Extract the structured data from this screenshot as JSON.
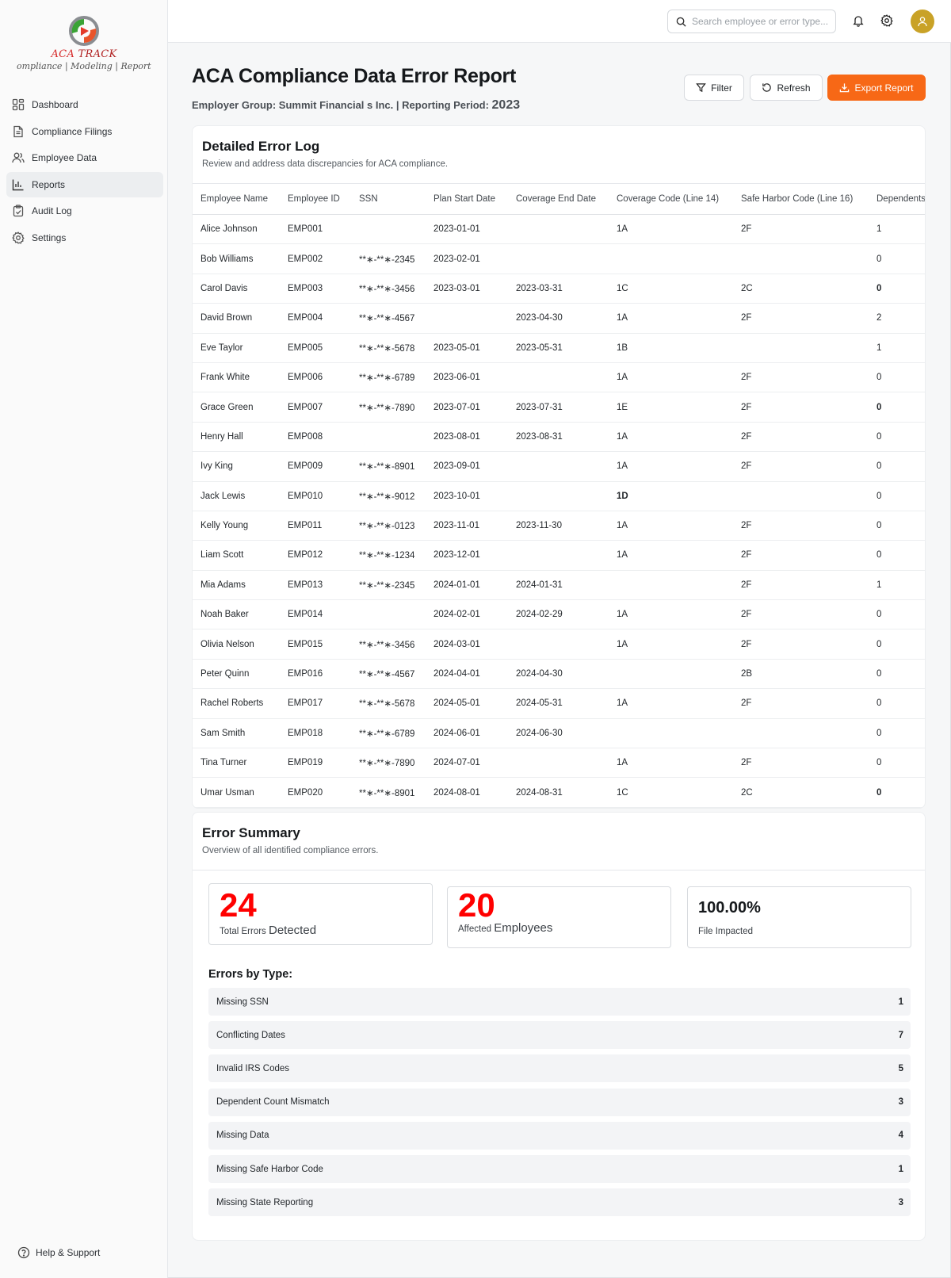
{
  "brand": {
    "name_a": "ACA",
    "name_b": "TRACK",
    "tagline": "ompliance | Modeling | Reportin"
  },
  "sidebar": {
    "items": [
      {
        "label": "Dashboard",
        "icon": "dashboard-icon"
      },
      {
        "label": "Compliance Filings",
        "icon": "document-icon"
      },
      {
        "label": "Employee Data",
        "icon": "users-icon"
      },
      {
        "label": "Reports",
        "icon": "bar-chart-icon",
        "active": true
      },
      {
        "label": "Audit Log",
        "icon": "clipboard-check-icon"
      },
      {
        "label": "Settings",
        "icon": "gear-icon"
      }
    ],
    "help_label": "Help & Support"
  },
  "topbar": {
    "search_placeholder": "Search employee or error type..."
  },
  "header": {
    "title": "ACA Compliance Data Error Report",
    "subtitle_prefix": "Employer Group: Summit Financial s Inc. | Reporting Period: ",
    "subtitle_year": "2023",
    "filter_label": "Filter",
    "refresh_label": "Refresh",
    "export_label": "Export Report"
  },
  "error_log": {
    "title": "Detailed Error Log",
    "description": "Review and address data discrepancies for ACA compliance.",
    "columns": [
      "Employee Name",
      "Employee ID",
      "SSN",
      "Plan Start Date",
      "Coverage End Date",
      "Coverage Code (Line 14)",
      "Safe Harbor Code (Line 16)",
      "Dependents"
    ],
    "rows": [
      [
        "Alice Johnson",
        "EMP001",
        "",
        "2023-01-01",
        "",
        "1A",
        "2F",
        "1"
      ],
      [
        "Bob Williams",
        "EMP002",
        "**∗-**∗-2345",
        "2023-02-01",
        "",
        "",
        "",
        "0"
      ],
      [
        "Carol Davis",
        "EMP003",
        "**∗-**∗-3456",
        "2023-03-01",
        "2023-03-31",
        "1C",
        "2C",
        "0"
      ],
      [
        "David Brown",
        "EMP004",
        "**∗-**∗-4567",
        "",
        "2023-04-30",
        "1A",
        "2F",
        "2"
      ],
      [
        "Eve Taylor",
        "EMP005",
        "**∗-**∗-5678",
        "2023-05-01",
        "2023-05-31",
        "1B",
        "",
        "1"
      ],
      [
        "Frank White",
        "EMP006",
        "**∗-**∗-6789",
        "2023-06-01",
        "",
        "1A",
        "2F",
        "0"
      ],
      [
        "Grace Green",
        "EMP007",
        "**∗-**∗-7890",
        "2023-07-01",
        "2023-07-31",
        "1E",
        "2F",
        "0"
      ],
      [
        "Henry Hall",
        "EMP008",
        "",
        "2023-08-01",
        "2023-08-31",
        "1A",
        "2F",
        "0"
      ],
      [
        "Ivy King",
        "EMP009",
        "**∗-**∗-8901",
        "2023-09-01",
        "",
        "1A",
        "2F",
        "0"
      ],
      [
        "Jack Lewis",
        "EMP010",
        "**∗-**∗-9012",
        "2023-10-01",
        "",
        "1D",
        "",
        "0"
      ],
      [
        "Kelly Young",
        "EMP011",
        "**∗-**∗-0123",
        "2023-11-01",
        "2023-11-30",
        "1A",
        "2F",
        "0"
      ],
      [
        "Liam Scott",
        "EMP012",
        "**∗-**∗-1234",
        "2023-12-01",
        "",
        "1A",
        "2F",
        "0"
      ],
      [
        "Mia Adams",
        "EMP013",
        "**∗-**∗-2345",
        "2024-01-01",
        "2024-01-31",
        "",
        "2F",
        "1"
      ],
      [
        "Noah Baker",
        "EMP014",
        "",
        "2024-02-01",
        "2024-02-29",
        "1A",
        "2F",
        "0"
      ],
      [
        "Olivia Nelson",
        "EMP015",
        "**∗-**∗-3456",
        "2024-03-01",
        "",
        "1A",
        "2F",
        "0"
      ],
      [
        "Peter Quinn",
        "EMP016",
        "**∗-**∗-4567",
        "2024-04-01",
        "2024-04-30",
        "",
        "2B",
        "0"
      ],
      [
        "Rachel Roberts",
        "EMP017",
        "**∗-**∗-5678",
        "2024-05-01",
        "2024-05-31",
        "1A",
        "2F",
        "0"
      ],
      [
        "Sam Smith",
        "EMP018",
        "**∗-**∗-6789",
        "2024-06-01",
        "2024-06-30",
        "",
        "",
        "0"
      ],
      [
        "Tina Turner",
        "EMP019",
        "**∗-**∗-7890",
        "2024-07-01",
        "",
        "1A",
        "2F",
        "0"
      ],
      [
        "Umar Usman",
        "EMP020",
        "**∗-**∗-8901",
        "2024-08-01",
        "2024-08-31",
        "1C",
        "2C",
        "0"
      ]
    ],
    "bold_cells": [
      [
        2,
        7
      ],
      [
        6,
        7
      ],
      [
        9,
        5
      ],
      [
        19,
        7
      ]
    ]
  },
  "summary": {
    "title": "Error Summary",
    "description": "Overview of all identified compliance errors.",
    "total_errors": "24",
    "total_errors_label_a": "Total Errors ",
    "total_errors_label_b": "Detected",
    "affected": "20",
    "affected_label_a": "Affected ",
    "affected_label_b": "Employees",
    "impact_pct": "100.00%",
    "impact_label": "File Impacted",
    "types_title": "Errors by Type:",
    "types": [
      {
        "label": "Missing SSN",
        "count": "1"
      },
      {
        "label": "Conflicting Dates",
        "count": "7"
      },
      {
        "label": "Invalid IRS Codes",
        "count": "5"
      },
      {
        "label": "Dependent Count Mismatch",
        "count": "3"
      },
      {
        "label": "Missing Data",
        "count": "4"
      },
      {
        "label": "Missing Safe Harbor Code",
        "count": "1"
      },
      {
        "label": "Missing State Reporting",
        "count": "3"
      }
    ]
  },
  "colors": {
    "accent": "#f76816",
    "error_number": "#ff0000",
    "avatar": "#c9a227"
  }
}
